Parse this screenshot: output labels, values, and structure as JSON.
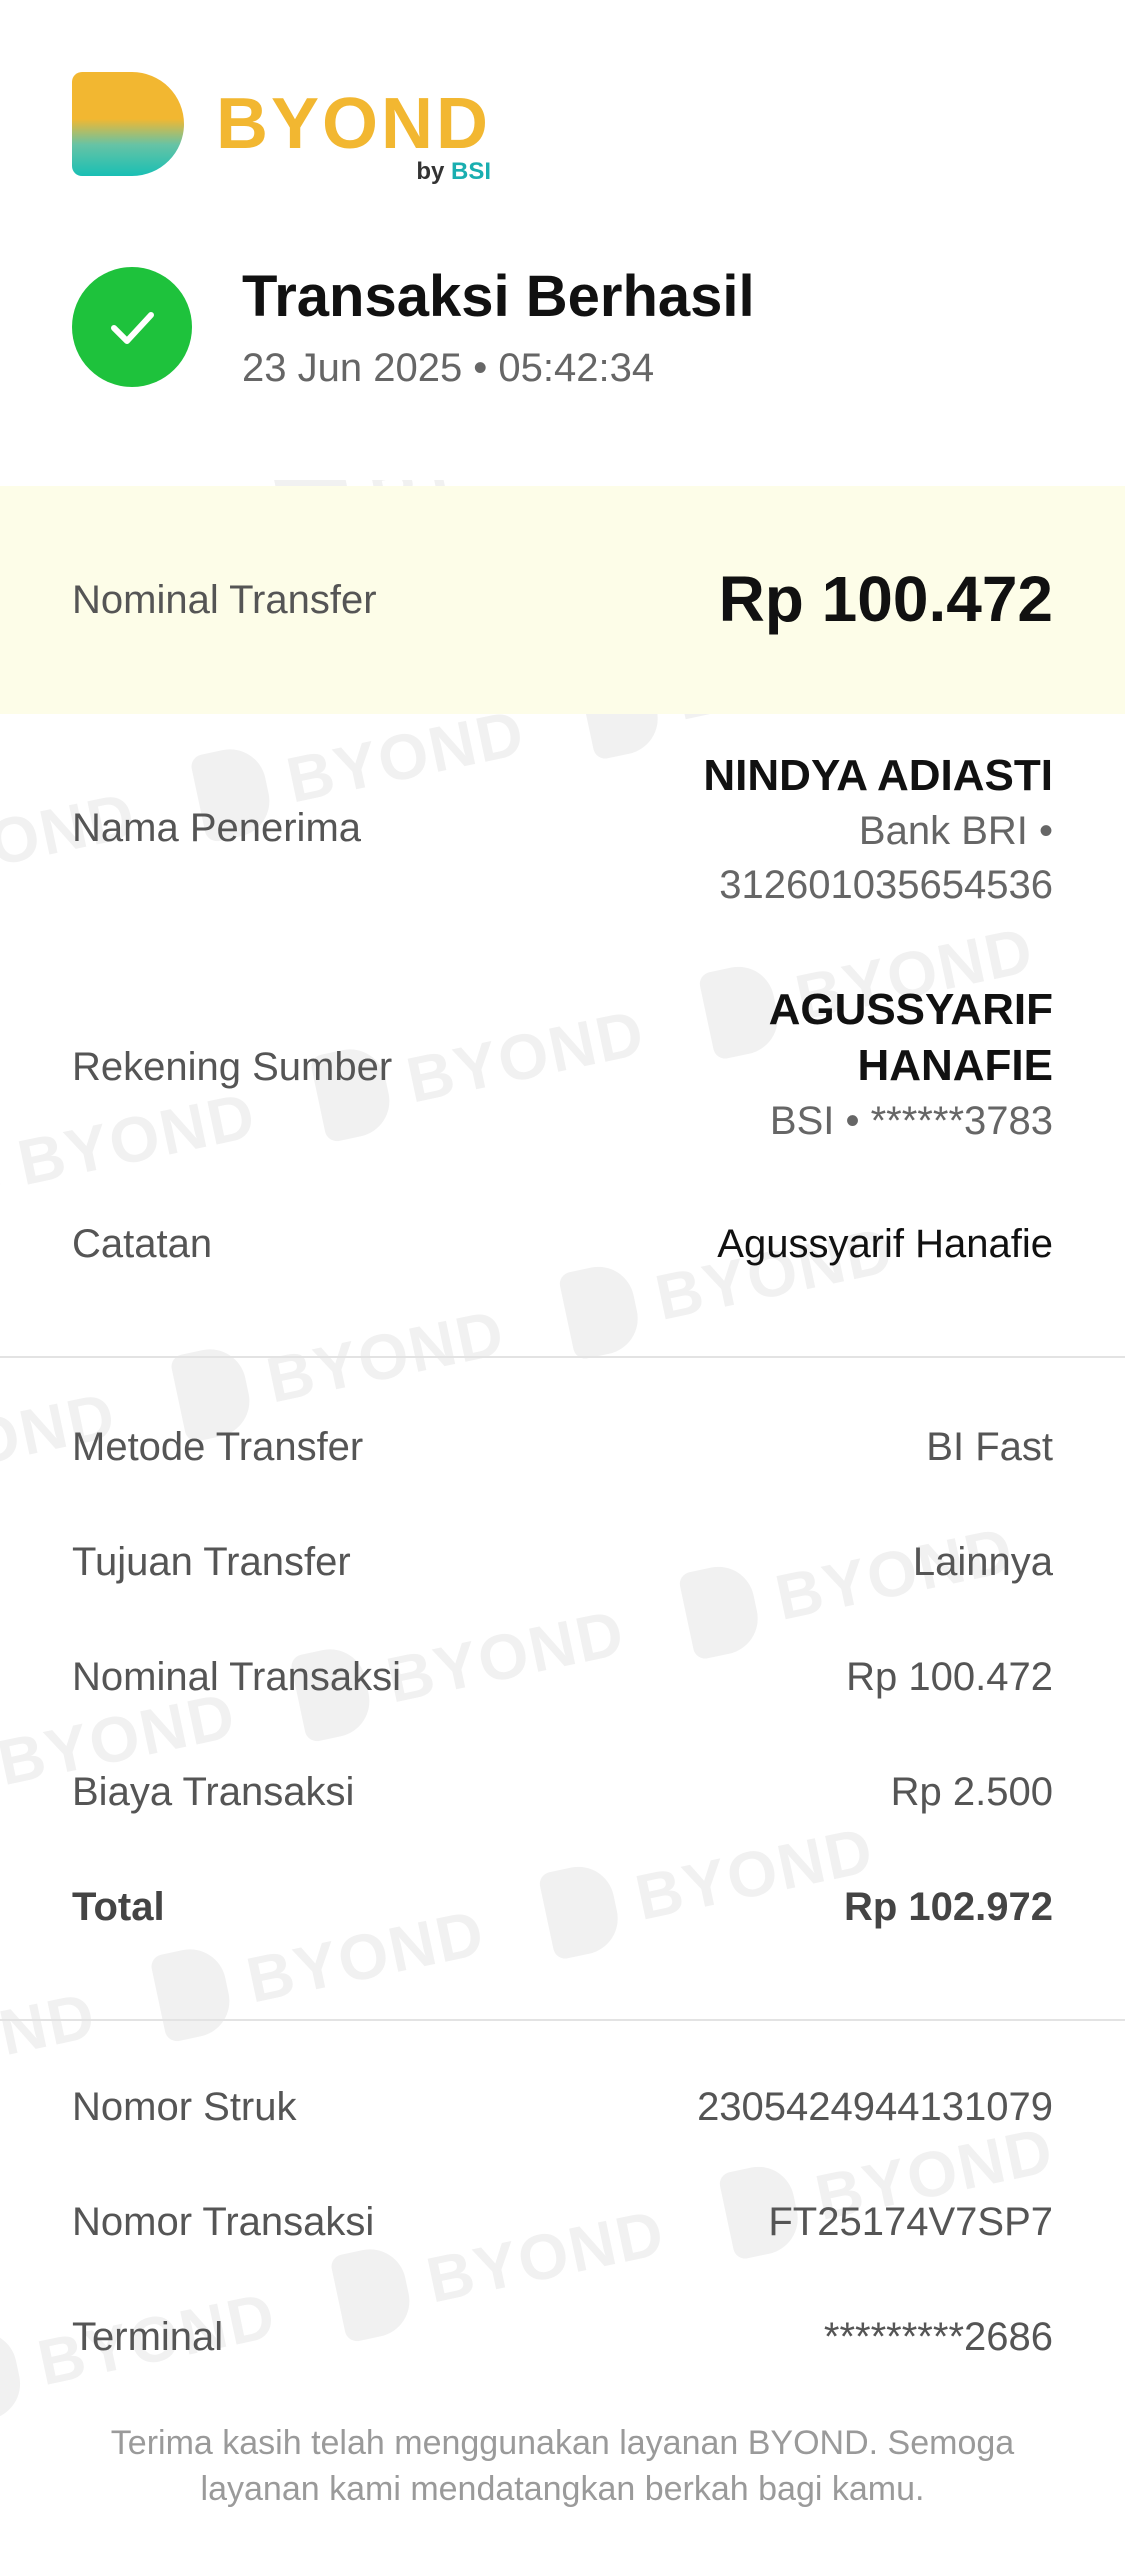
{
  "brand": {
    "name": "BYOND",
    "by": "by",
    "parent": "BSI",
    "colors": {
      "yellow": "#f2b731",
      "teal": "#19bfb4",
      "success": "#1ec23c"
    }
  },
  "status": {
    "icon": "check-icon",
    "title": "Transaksi Berhasil",
    "datetime": "23 Jun 2025 • 05:42:34"
  },
  "nominal": {
    "label": "Nominal Transfer",
    "amount": "Rp 100.472"
  },
  "recipient": {
    "label": "Nama Penerima",
    "name": "NINDYA ADIASTI",
    "bank": "Bank BRI •",
    "account": "312601035654536"
  },
  "source": {
    "label": "Rekening Sumber",
    "name_line1": "AGUSSYARIF",
    "name_line2": "HANAFIE",
    "account": "BSI • ******3783"
  },
  "note": {
    "label": "Catatan",
    "value": "Agussyarif Hanafie"
  },
  "details": [
    {
      "label": "Metode Transfer",
      "value": "BI Fast"
    },
    {
      "label": "Tujuan Transfer",
      "value": "Lainnya"
    },
    {
      "label": "Nominal Transaksi",
      "value": "Rp 100.472"
    },
    {
      "label": "Biaya Transaksi",
      "value": "Rp 2.500"
    },
    {
      "label": "Total",
      "value": "Rp 102.972"
    }
  ],
  "reference": [
    {
      "label": "Nomor Struk",
      "value": "2305424944131079"
    },
    {
      "label": "Nomor Transaksi",
      "value": "FT25174V7SP7"
    },
    {
      "label": "Terminal",
      "value": "*********2686"
    }
  ],
  "footer": "Terima kasih telah menggunakan layanan BYOND. Semoga layanan kami mendatangkan berkah bagi kamu.",
  "watermark_text": "BYOND"
}
